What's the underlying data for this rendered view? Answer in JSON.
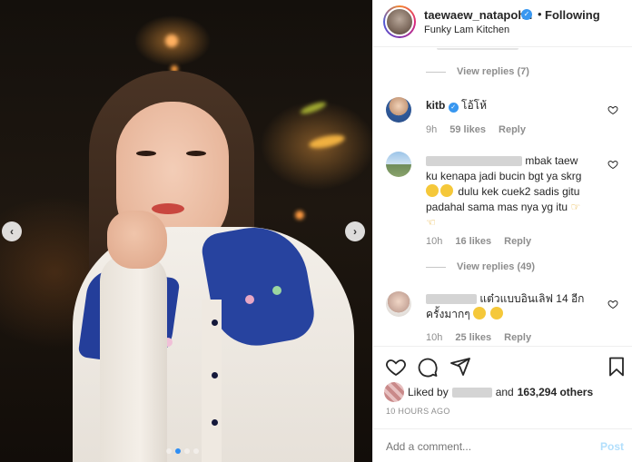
{
  "post": {
    "author": "taewaew_natapohn",
    "follow_status": "Following",
    "location": "Funky Lam Kitchen"
  },
  "icons": {
    "verified": "verified-badge-icon",
    "prev": "chevron-left-icon",
    "next": "chevron-right-icon",
    "heart": "heart-icon",
    "comment": "comment-icon",
    "share": "share-icon",
    "save": "bookmark-icon"
  },
  "colors": {
    "verified": "#3897f0",
    "accent_dot": "#2f8ef4",
    "post_button": "#b2dffc",
    "muted_text": "#8e8e8e"
  },
  "comments": {
    "view_replies_1": "View replies (7)",
    "c1": {
      "username": "kitb",
      "text": "โอ้โห้",
      "time": "9h",
      "likes": "59 likes",
      "reply": "Reply"
    },
    "c2": {
      "line1": "mbak taew",
      "line2": "ku kenapa jadi bucin bgt ya skrg",
      "line3": "dulu kek cuek2 sadis gitu",
      "line4": "padahal sama mas nya yg itu",
      "time": "10h",
      "likes": "16 likes",
      "reply": "Reply"
    },
    "view_replies_2": "View replies (49)",
    "c3": {
      "line1": "แต๋วแบบอินเลิฟ 14 อีก",
      "line2": "ครั้งมากๆ",
      "time": "10h",
      "likes": "25 likes",
      "reply": "Reply"
    }
  },
  "likes": {
    "prefix": "Liked by",
    "and": "and",
    "others": "163,294 others"
  },
  "timestamp": "10 HOURS AGO",
  "composer": {
    "placeholder": "Add a comment...",
    "post_label": "Post"
  },
  "carousel": {
    "slides": 4,
    "active_index": 1
  }
}
